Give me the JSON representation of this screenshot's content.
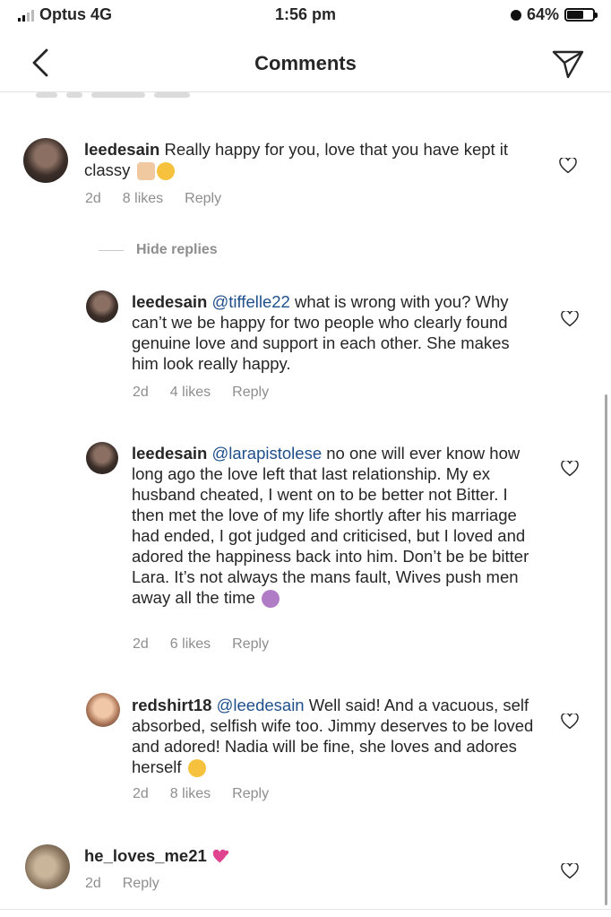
{
  "status": {
    "carrier": "Optus 4G",
    "time": "1:56 pm",
    "battery": "64%"
  },
  "nav": {
    "title": "Comments"
  },
  "comments": [
    {
      "user": "leedesain",
      "text": "Really happy for you, love that you have kept it classy",
      "age": "2d",
      "likes": "8 likes",
      "reply": "Reply"
    }
  ],
  "hide_replies": "Hide replies",
  "replies": [
    {
      "user": "leedesain",
      "mention": "@tiffelle22",
      "text": " what is wrong with you? Why can’t we be happy for two people who clearly found genuine love and support in each other. She makes him look really happy.",
      "age": "2d",
      "likes": "4 likes",
      "reply": "Reply"
    },
    {
      "user": "leedesain",
      "mention": "@larapistolese",
      "text": " no one will ever know how long ago the love left that last relationship. My ex husband cheated, I went on to be better not Bitter. I then met the love of my life shortly after his marriage had ended, I got judged and criticised, but I loved and adored the happiness back into him. Don’t be be bitter Lara. It’s not always the mans fault, Wives push men away all the time",
      "age": "2d",
      "likes": "6 likes",
      "reply": "Reply"
    },
    {
      "user": "redshirt18",
      "mention": "@leedesain",
      "text": " Well said! And a vacuous, self absorbed, selfish wife too. Jimmy deserves to be loved and adored! Nadia will be fine, she loves and adores herself",
      "age": "2d",
      "likes": "8 likes",
      "reply": "Reply"
    }
  ],
  "last_comment": {
    "user": "he_loves_me21",
    "age": "2d",
    "reply": "Reply"
  },
  "colors": {
    "mention": "#1f4f8b",
    "meta": "#8e8e8e",
    "text": "#262626",
    "heart_emoji": "#e0448f"
  }
}
